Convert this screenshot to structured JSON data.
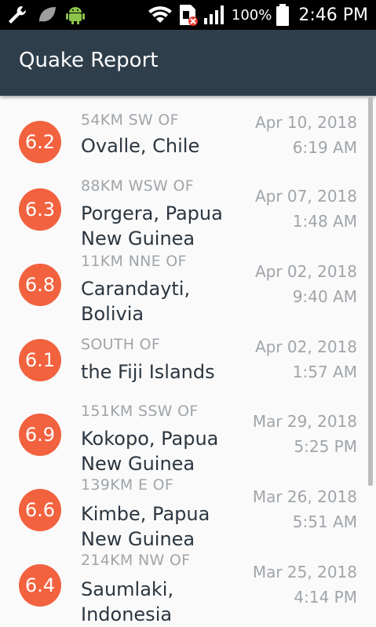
{
  "status_bar": {
    "battery": "100%",
    "time": "2:46 PM",
    "icons": [
      "wrench-icon",
      "leaf-icon",
      "android-icon",
      "wifi-icon",
      "sim-error-icon",
      "signal-icon",
      "battery-icon"
    ]
  },
  "app_bar": {
    "title": "Quake Report"
  },
  "quakes": [
    {
      "mag": "6.2",
      "offset": "54KM SW OF",
      "place": "Ovalle, Chile",
      "date": "Apr 10, 2018",
      "time": "6:19 AM"
    },
    {
      "mag": "6.3",
      "offset": "88KM WSW OF",
      "place": "Porgera, Papua New Guinea",
      "date": "Apr 07, 2018",
      "time": "1:48 AM"
    },
    {
      "mag": "6.8",
      "offset": "11KM NNE OF",
      "place": "Carandayti, Bolivia",
      "date": "Apr 02, 2018",
      "time": "9:40 AM"
    },
    {
      "mag": "6.1",
      "offset": "SOUTH OF",
      "place": "the Fiji Islands",
      "date": "Apr 02, 2018",
      "time": "1:57 AM"
    },
    {
      "mag": "6.9",
      "offset": "151KM SSW OF",
      "place": "Kokopo, Papua New Guinea",
      "date": "Mar 29, 2018",
      "time": "5:25 PM"
    },
    {
      "mag": "6.6",
      "offset": "139KM E OF",
      "place": "Kimbe, Papua New Guinea",
      "date": "Mar 26, 2018",
      "time": "5:51 AM"
    },
    {
      "mag": "6.4",
      "offset": "214KM NW OF",
      "place": "Saumlaki, Indonesia",
      "date": "Mar 25, 2018",
      "time": "4:14 PM"
    }
  ],
  "colors": {
    "app_bar": "#2f3e4b",
    "magnitude_circle": "#f2623f",
    "secondary_text": "#a0a5aa",
    "primary_text": "#2b3640"
  }
}
